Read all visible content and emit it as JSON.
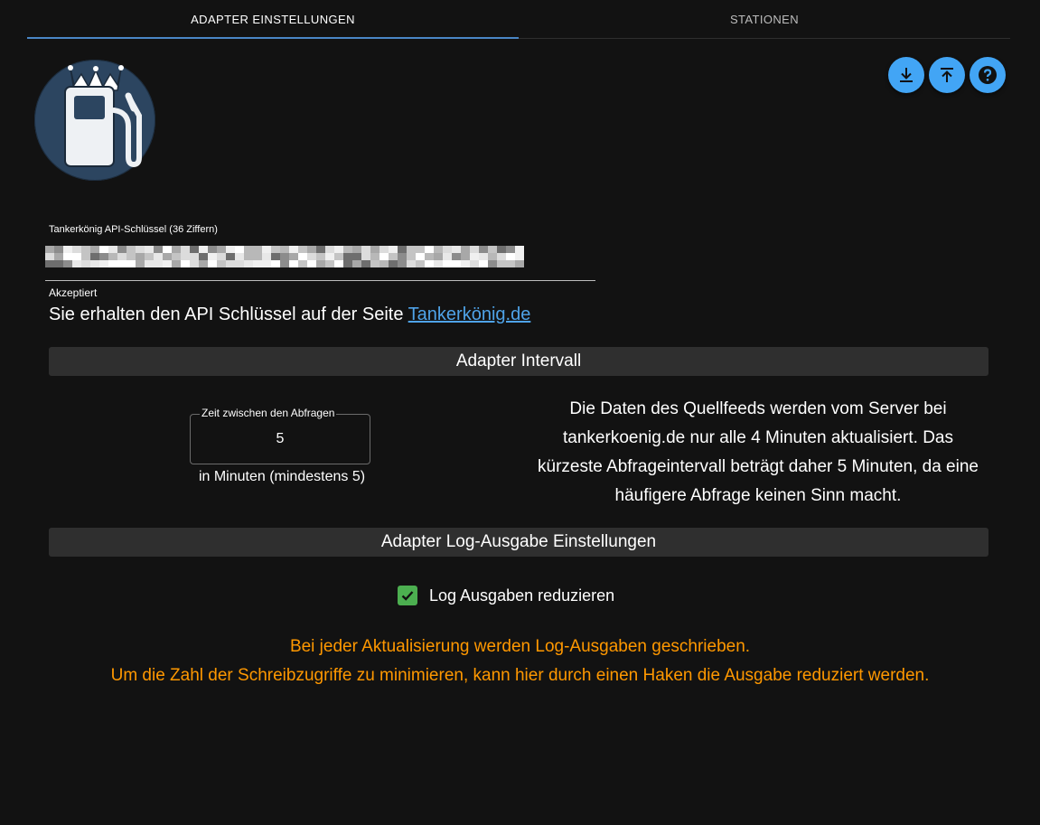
{
  "tabs": [
    {
      "label": "ADAPTER EINSTELLUNGEN",
      "active": true
    },
    {
      "label": "STATIONEN",
      "active": false
    }
  ],
  "toolbar": {
    "download_icon": "download-icon",
    "upload_icon": "upload-icon",
    "help_icon": "help-icon"
  },
  "api_key": {
    "label": "Tankerkönig API-Schlüssel (36 Ziffern)",
    "value_masked": true,
    "helper": "Akzeptiert",
    "info_text": "Sie erhalten den API Schlüssel auf der Seite ",
    "info_link": "Tankerkönig.de"
  },
  "sections": {
    "interval_title": "Adapter Intervall",
    "log_title": "Adapter Log-Ausgabe Einstellungen"
  },
  "interval": {
    "legend": "Zeit zwischen den Abfragen",
    "value": "5",
    "helper": "in Minuten (mindestens 5)",
    "description": "Die Daten des Quellfeeds werden vom Server bei tankerkoenig.de nur alle 4 Minuten aktualisiert. Das kürzeste Abfrageintervall beträgt daher 5 Minuten, da eine häufigere Abfrage keinen Sinn macht."
  },
  "log": {
    "checkbox_label": "Log Ausgaben reduzieren",
    "checked": true,
    "info_line1": "Bei jeder Aktualisierung werden Log-Ausgaben geschrieben.",
    "info_line2": "Um die Zahl der Schreibzugriffe zu minimieren, kann hier durch einen Haken die Ausgabe reduziert werden."
  },
  "colors": {
    "accent": "#42a5f5",
    "tab_indicator": "#4a86c5",
    "link": "#4fa3e8",
    "checkbox": "#4caf50",
    "warning_text": "#ff9800",
    "background": "#121212",
    "section_bg": "#2f2f2f"
  }
}
